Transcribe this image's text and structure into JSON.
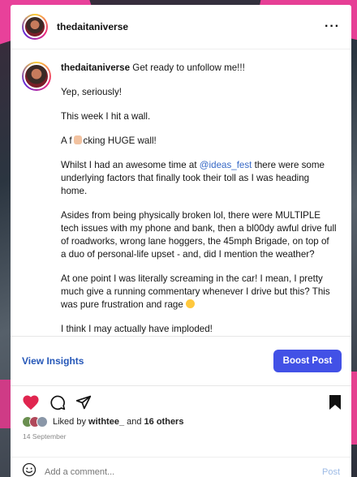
{
  "post": {
    "username": "thedaitaniverse",
    "more_label": "···"
  },
  "caption": {
    "username": "thedaitaniverse",
    "intro": "Get ready to unfollow me!!!",
    "line2": "Yep, seriously!",
    "line3": "This week I hit a wall.",
    "line4_start": "A f",
    "line4_end": "cking HUGE wall!",
    "p5_start": "Whilst I had an awesome time at",
    "p5_mention": "@ideas_fest",
    "p5_end": "there were some underlying factors that finally took their toll as I was heading home.",
    "p6": "Asides from being physically broken lol, there were MULTIPLE tech issues with my phone and bank, then a bl00dy awful drive full of roadworks, wrong lane hoggers, the 45mph Brigade, on top of a duo of personal-life upset - and, did I mention the weather?",
    "p7": "At one point I was literally screaming in the car! I mean, I pretty much give a running commentary whenever I drive but this? This was pure frustration and rage",
    "p8": "I think I may actually have imploded!"
  },
  "insights": {
    "view_label": "View Insights",
    "boost_label": "Boost Post"
  },
  "likes": {
    "prefix": "Liked by",
    "user": "withtee_",
    "and": "and",
    "others": "16 others"
  },
  "date": "14 September",
  "comment": {
    "placeholder": "Add a comment...",
    "post_label": "Post"
  },
  "colors": {
    "heart": "#e0254f",
    "boost": "#4251e6",
    "link": "#2557b8"
  }
}
